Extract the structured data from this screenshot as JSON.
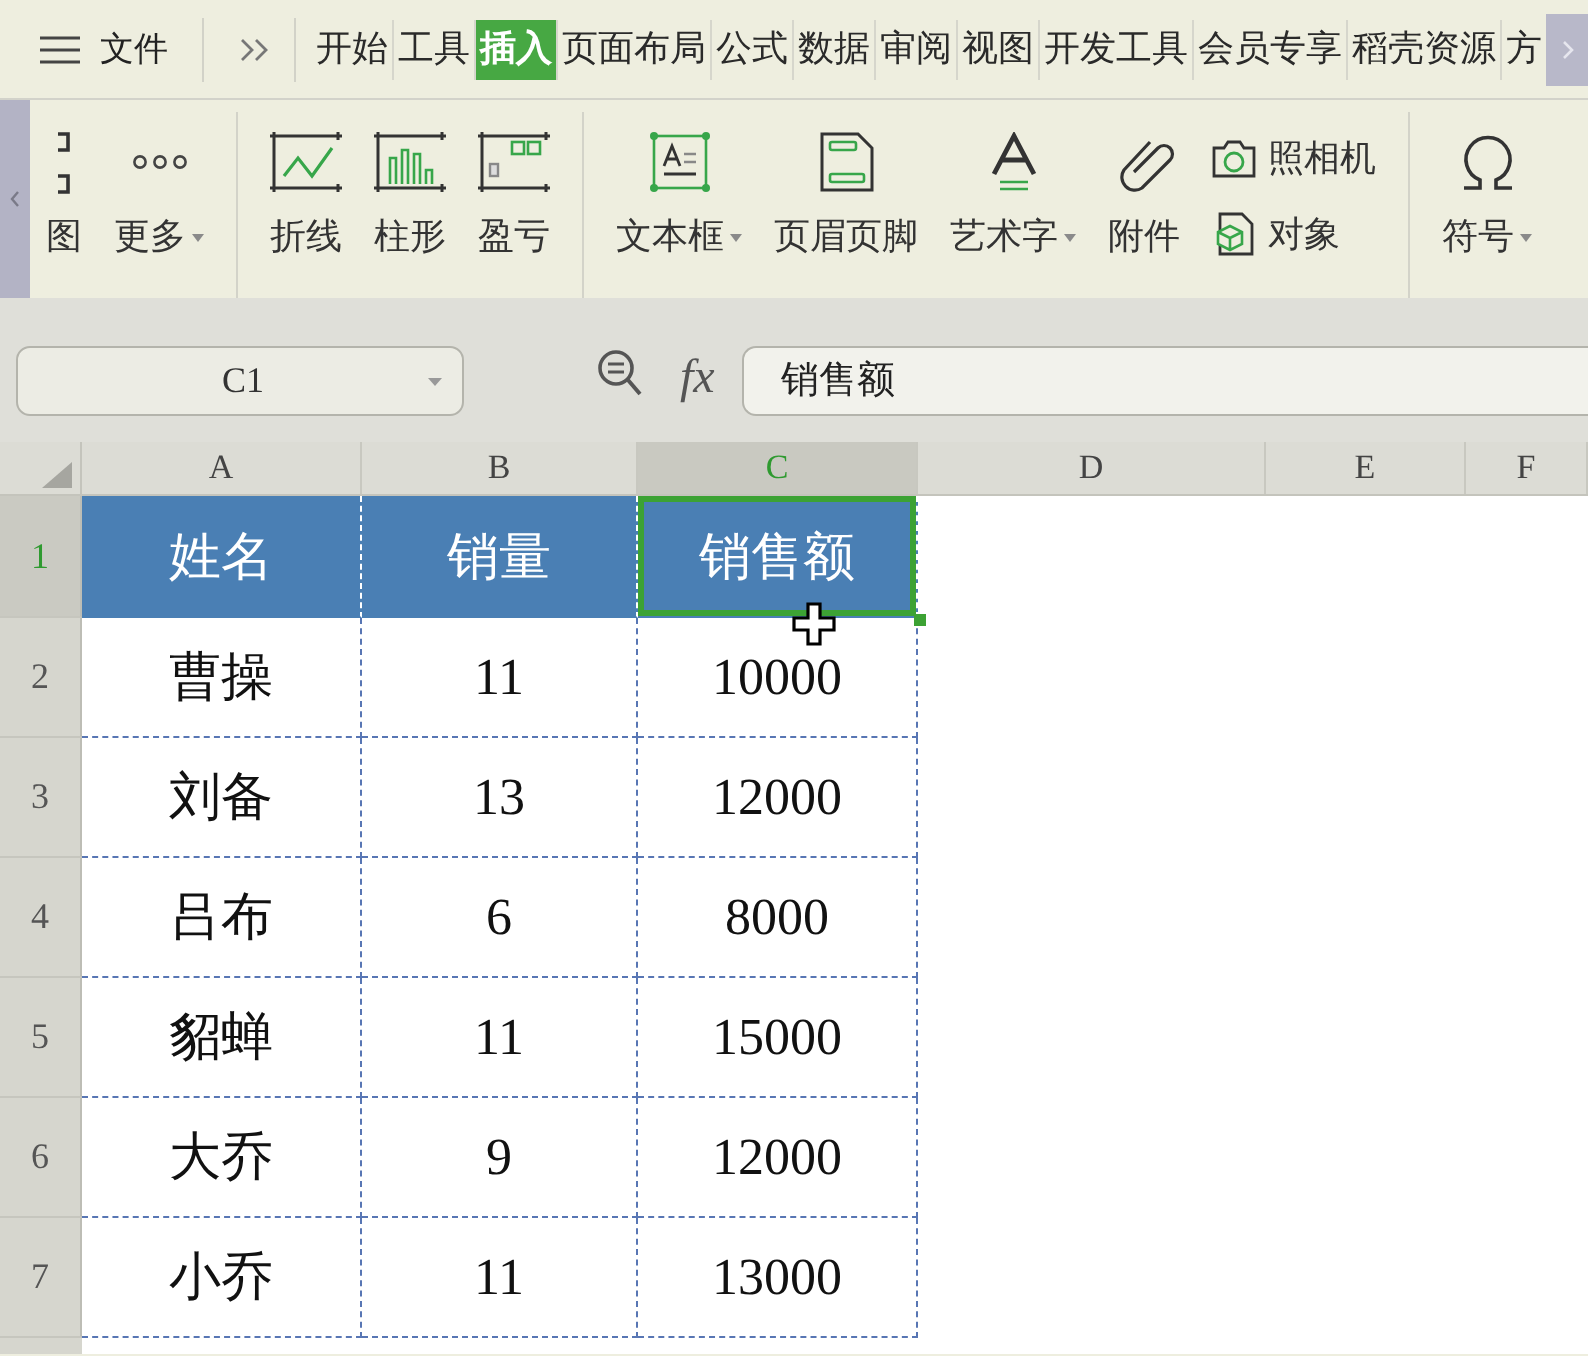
{
  "menu_bar": {
    "menu_label": "文件",
    "tabs": [
      {
        "label": "开始",
        "selected": false
      },
      {
        "label": "工具",
        "selected": false
      },
      {
        "label": "插入",
        "selected": true
      },
      {
        "label": "页面布局",
        "selected": false
      },
      {
        "label": "公式",
        "selected": false
      },
      {
        "label": "数据",
        "selected": false
      },
      {
        "label": "审阅",
        "selected": false
      },
      {
        "label": "视图",
        "selected": false
      },
      {
        "label": "开发工具",
        "selected": false
      },
      {
        "label": "会员专享",
        "selected": false
      },
      {
        "label": "稻壳资源",
        "selected": false
      },
      {
        "label": "方",
        "selected": false
      }
    ]
  },
  "ribbon": {
    "groups": [
      {
        "items": [
          {
            "kind": "large",
            "label": "图",
            "dropdown": false
          },
          {
            "kind": "large",
            "label": "更多",
            "dropdown": true
          }
        ]
      },
      {
        "items": [
          {
            "kind": "large",
            "label": "折线",
            "dropdown": false
          },
          {
            "kind": "large",
            "label": "柱形",
            "dropdown": false
          },
          {
            "kind": "large",
            "label": "盈亏",
            "dropdown": false
          }
        ]
      },
      {
        "items": [
          {
            "kind": "large",
            "label": "文本框",
            "dropdown": true
          },
          {
            "kind": "large",
            "label": "页眉页脚",
            "dropdown": false
          },
          {
            "kind": "large",
            "label": "艺术字",
            "dropdown": true
          },
          {
            "kind": "large",
            "label": "附件",
            "dropdown": false
          },
          {
            "kind": "small",
            "label": "照相机",
            "dropdown": false
          },
          {
            "kind": "small",
            "label": "对象",
            "dropdown": false
          }
        ]
      },
      {
        "items": [
          {
            "kind": "large",
            "label": "符号",
            "dropdown": true
          }
        ]
      }
    ]
  },
  "formula_bar": {
    "name_box": {
      "value": "C1"
    },
    "function_label": "fx",
    "formula": {
      "value": "销售额"
    }
  },
  "sheet": {
    "columns": [
      {
        "label": "A",
        "selected": false
      },
      {
        "label": "B",
        "selected": false
      },
      {
        "label": "C",
        "selected": true
      },
      {
        "label": "D",
        "selected": false
      },
      {
        "label": "E",
        "selected": false
      },
      {
        "label": "F",
        "selected": false
      }
    ],
    "rows": [
      {
        "number": "1",
        "kind": "header",
        "selected": true,
        "cells": [
          {
            "text": "姓名",
            "selected": false
          },
          {
            "text": "销量",
            "selected": false
          },
          {
            "text": "销售额",
            "selected": true
          }
        ]
      },
      {
        "number": "2",
        "kind": "data",
        "selected": false,
        "cells": [
          {
            "text": "曹操",
            "selected": false
          },
          {
            "text": "11",
            "selected": false
          },
          {
            "text": "10000",
            "selected": false
          }
        ]
      },
      {
        "number": "3",
        "kind": "data",
        "selected": false,
        "cells": [
          {
            "text": "刘备",
            "selected": false
          },
          {
            "text": "13",
            "selected": false
          },
          {
            "text": "12000",
            "selected": false
          }
        ]
      },
      {
        "number": "4",
        "kind": "data",
        "selected": false,
        "cells": [
          {
            "text": "吕布",
            "selected": false
          },
          {
            "text": "6",
            "selected": false
          },
          {
            "text": "8000",
            "selected": false
          }
        ]
      },
      {
        "number": "5",
        "kind": "data",
        "selected": false,
        "cells": [
          {
            "text": "貂蝉",
            "selected": false
          },
          {
            "text": "11",
            "selected": false
          },
          {
            "text": "15000",
            "selected": false
          }
        ]
      },
      {
        "number": "6",
        "kind": "data",
        "selected": false,
        "cells": [
          {
            "text": "大乔",
            "selected": false
          },
          {
            "text": "9",
            "selected": false
          },
          {
            "text": "12000",
            "selected": false
          }
        ]
      },
      {
        "number": "7",
        "kind": "data",
        "selected": false,
        "cells": [
          {
            "text": "小乔",
            "selected": false
          },
          {
            "text": "11",
            "selected": false
          },
          {
            "text": "13000",
            "selected": false
          }
        ]
      }
    ]
  }
}
